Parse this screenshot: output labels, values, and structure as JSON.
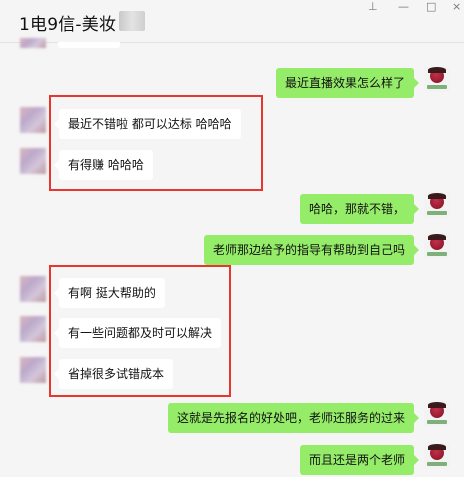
{
  "window": {
    "title": "1电9信-美妆",
    "controls": {
      "pin": "⊥",
      "minimize": "—",
      "maximize": "□",
      "close": "×"
    }
  },
  "messages": [
    {
      "side": "right",
      "text": "最近直播效果怎么样了"
    },
    {
      "side": "left",
      "text": "最近不错啦 都可以达标 哈哈哈"
    },
    {
      "side": "left",
      "text": "有得赚 哈哈哈"
    },
    {
      "side": "right",
      "text": "哈哈，那就不错，"
    },
    {
      "side": "right",
      "text": "老师那边给予的指导有帮助到自己吗"
    },
    {
      "side": "left",
      "text": "有啊 挺大帮助的"
    },
    {
      "side": "left",
      "text": "有一些问题都及时可以解决"
    },
    {
      "side": "left",
      "text": "省掉很多试错成本"
    },
    {
      "side": "right",
      "text": "这就是先报名的好处吧，老师还服务的过来"
    },
    {
      "side": "right",
      "text": "而且还是两个老师"
    }
  ],
  "colors": {
    "right_bubble": "#95ec69",
    "left_bubble": "#ffffff",
    "highlight": "#e8352e",
    "background": "#f5f5f5"
  }
}
